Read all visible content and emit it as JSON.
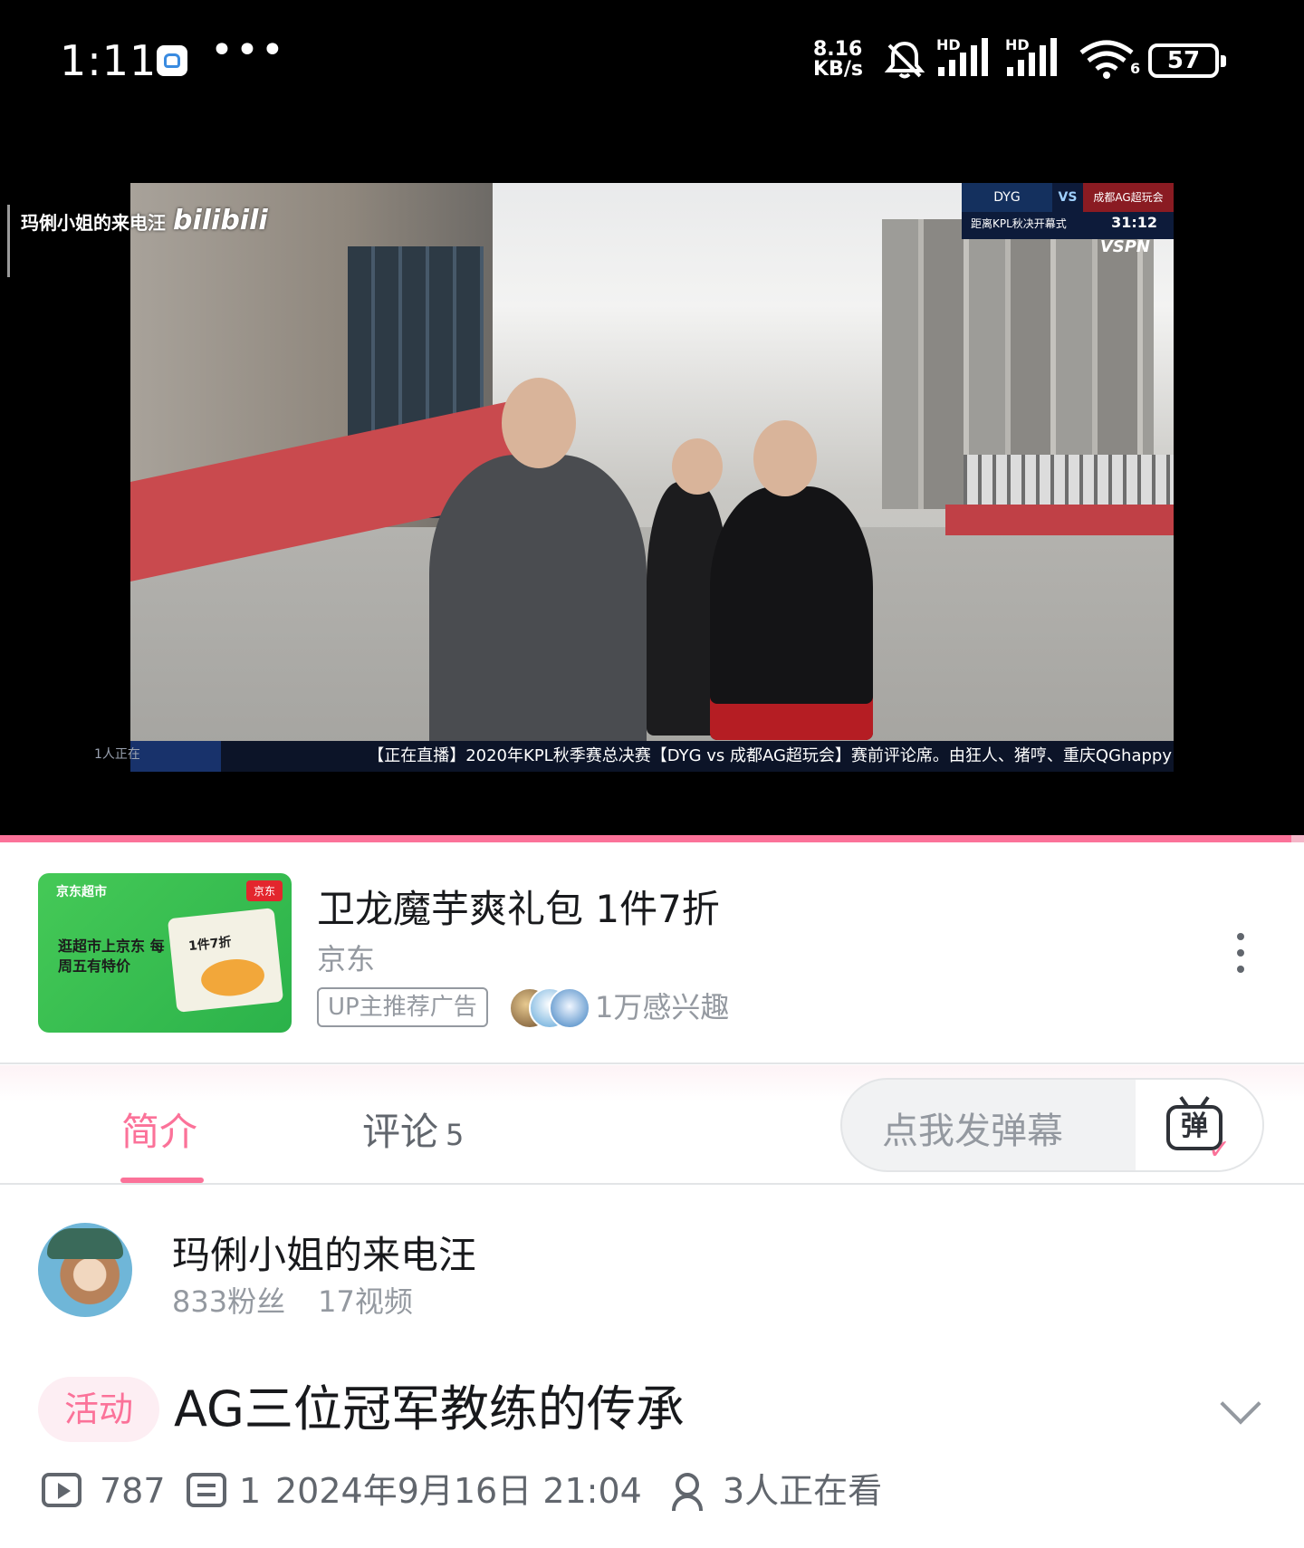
{
  "status_bar": {
    "time": "1:11",
    "more": "•••",
    "net_speed_value": "8.16",
    "net_speed_unit": "KB/s",
    "signal1_label": "HD",
    "signal2_label": "HD",
    "wifi_label": "6",
    "battery": "57",
    "icons": [
      "app-notification-icon",
      "mute-bell-icon",
      "signal-icon",
      "signal-icon",
      "wifi-icon",
      "battery-icon"
    ]
  },
  "player": {
    "watermark_user": "玛俐小姐的来电汪",
    "watermark_brand": "bilibili",
    "scoreboard": {
      "team_a": "DYG",
      "vs": "VS",
      "team_b": "成都AG超玩会",
      "countdown_label": "距离KPL秋决开幕式",
      "countdown": "31:12",
      "broadcaster": "VSPN"
    },
    "ticker": "【正在直播】2020年KPL秋季赛总决赛【DYG vs 成都AG超玩会】赛前评论席。由狂人、猪哼、重庆QGhappy",
    "viewers_overlay": "1人正在",
    "progress": 0.99,
    "colors": {
      "progress": "#fb7299",
      "progress_track": "#f4b6c8"
    }
  },
  "ad": {
    "thumb_brand": "京东超市",
    "thumb_badge": "京东",
    "thumb_slogan": "逛超市上京东 每周五有特价",
    "thumb_pack_text": "1件7折",
    "title": "卫龙魔芋爽礼包 1件7折",
    "advertiser": "京东",
    "tag": "UP主推荐广告",
    "interest": "1万感兴趣"
  },
  "tabs": {
    "intro": "简介",
    "comments": "评论",
    "comments_count": "5",
    "danmaku_placeholder": "点我发弹幕",
    "danmaku_button": "弹"
  },
  "uploader": {
    "name": "玛俐小姐的来电汪",
    "fans": "833粉丝",
    "videos": "17视频"
  },
  "video": {
    "activity_tag": "活动",
    "title": "AG三位冠军教练的传承",
    "views": "787",
    "danmaku_count": "1",
    "publish_time": "2024年9月16日 21:04",
    "watching": "3人正在看"
  },
  "colors": {
    "accent": "#fb7299",
    "text_primary": "#18191c",
    "text_secondary": "#9499a0"
  }
}
